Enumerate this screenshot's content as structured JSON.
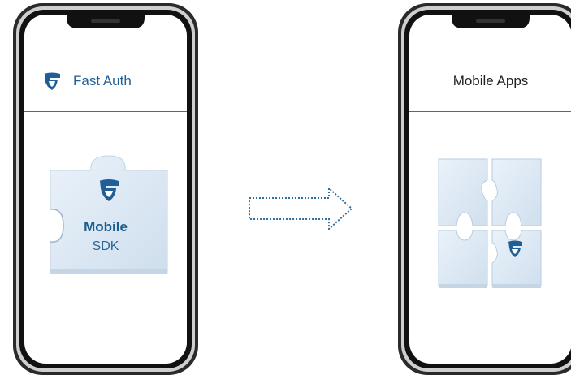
{
  "left_phone": {
    "header": {
      "title": "Fast Auth",
      "icon": "shield-logo-icon"
    },
    "puzzle_piece": {
      "title": "Mobile",
      "subtitle": "SDK",
      "icon": "shield-logo-icon"
    }
  },
  "right_phone": {
    "header": {
      "title": "Mobile Apps"
    },
    "puzzle_group": {
      "icon": "shield-logo-icon"
    }
  },
  "arrow": {
    "icon": "dotted-right-arrow-icon"
  },
  "colors": {
    "brand": "#1f5f96",
    "puzzle": "#dce8f4",
    "frame": "#1a1a1a"
  }
}
